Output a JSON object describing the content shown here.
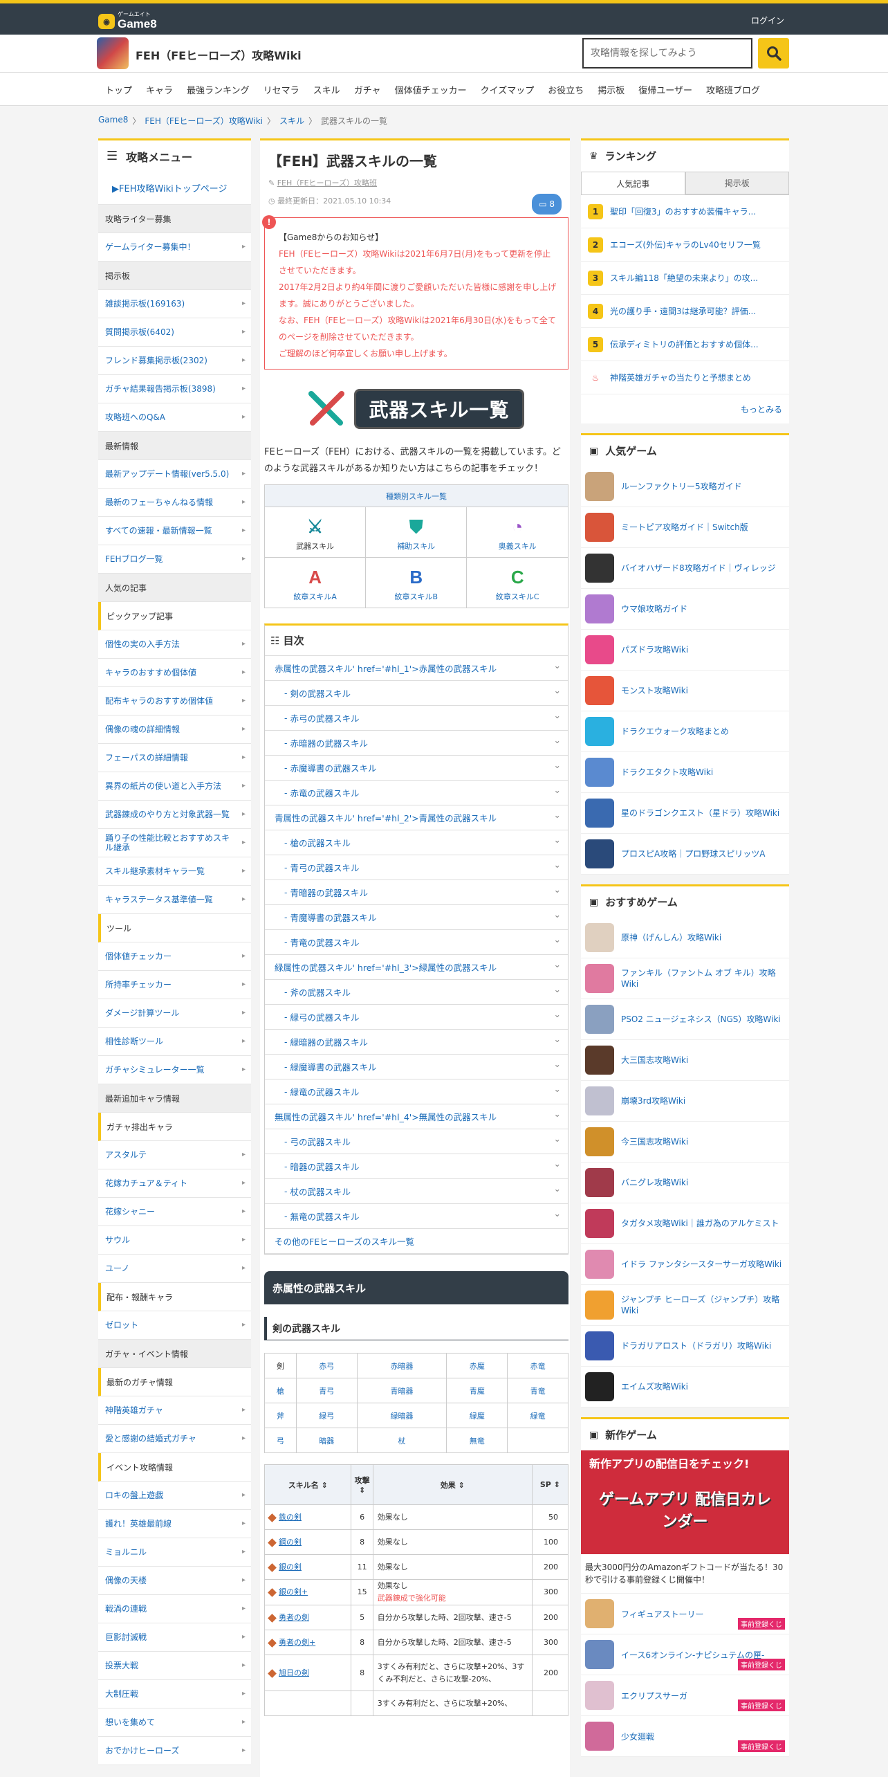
{
  "site": {
    "logo_small": "ゲームエイト",
    "logo": "Game8",
    "login": "ログイン",
    "title": "FEH（FEヒーローズ）攻略Wiki",
    "search_placeholder": "攻略情報を探してみよう"
  },
  "nav": [
    "トップ",
    "キャラ",
    "最強ランキング",
    "リセマラ",
    "スキル",
    "ガチャ",
    "個体値チェッカー",
    "クイズマップ",
    "お役立ち",
    "掲示板",
    "復帰ユーザー",
    "攻略班ブログ"
  ],
  "crumbs": [
    "Game8",
    "FEH（FEヒーローズ）攻略Wiki",
    "スキル",
    "武器スキルの一覧"
  ],
  "crumb_sep": "〉",
  "menu": {
    "title": "攻略メニュー",
    "top": "▶FEH攻略Wikiトップページ",
    "items": [
      {
        "t": "sec",
        "l": "攻略ライター募集"
      },
      {
        "t": "link",
        "l": "ゲームライター募集中！"
      },
      {
        "t": "sec",
        "l": "掲示板"
      },
      {
        "t": "link",
        "l": "雑談掲示板(169163)"
      },
      {
        "t": "link",
        "l": "質問掲示板(6402)"
      },
      {
        "t": "link",
        "l": "フレンド募集掲示板(2302)"
      },
      {
        "t": "link",
        "l": "ガチャ結果報告掲示板(3898)"
      },
      {
        "t": "link",
        "l": "攻略班へのQ&A"
      },
      {
        "t": "sec",
        "l": "最新情報"
      },
      {
        "t": "link",
        "l": "最新アップデート情報(ver5.5.0)"
      },
      {
        "t": "link",
        "l": "最新のフェーちゃんねる情報"
      },
      {
        "t": "link",
        "l": "すべての速報・最新情報一覧"
      },
      {
        "t": "link",
        "l": "FEHブログ一覧"
      },
      {
        "t": "sec",
        "l": "人気の記事"
      },
      {
        "t": "sub",
        "l": "ピックアップ記事"
      },
      {
        "t": "link",
        "l": "個性の実の入手方法"
      },
      {
        "t": "link",
        "l": "キャラのおすすめ個体値"
      },
      {
        "t": "link",
        "l": "配布キャラのおすすめ個体値"
      },
      {
        "t": "link",
        "l": "偶像の魂の詳細情報"
      },
      {
        "t": "link",
        "l": "フェーパスの詳細情報"
      },
      {
        "t": "link",
        "l": "異界の紙片の使い道と入手方法"
      },
      {
        "t": "link",
        "l": "武器錬成のやり方と対象武器一覧"
      },
      {
        "t": "link",
        "l": "踊り子の性能比較とおすすめスキル継承"
      },
      {
        "t": "link",
        "l": "スキル継承素材キャラ一覧"
      },
      {
        "t": "link",
        "l": "キャラステータス基準値一覧"
      },
      {
        "t": "sub",
        "l": "ツール"
      },
      {
        "t": "link",
        "l": "個体値チェッカー"
      },
      {
        "t": "link",
        "l": "所持率チェッカー"
      },
      {
        "t": "link",
        "l": "ダメージ計算ツール"
      },
      {
        "t": "link",
        "l": "相性診断ツール"
      },
      {
        "t": "link",
        "l": "ガチャシミュレーター一覧"
      },
      {
        "t": "sec",
        "l": "最新追加キャラ情報"
      },
      {
        "t": "sub",
        "l": "ガチャ排出キャラ"
      },
      {
        "t": "link",
        "l": "アスタルテ"
      },
      {
        "t": "link",
        "l": "花嫁カチュア＆ティト"
      },
      {
        "t": "link",
        "l": "花嫁シャニー"
      },
      {
        "t": "link",
        "l": "サウル"
      },
      {
        "t": "link",
        "l": "ユーノ"
      },
      {
        "t": "sub",
        "l": "配布・報酬キャラ"
      },
      {
        "t": "link",
        "l": "ゼロット"
      },
      {
        "t": "sec",
        "l": "ガチャ・イベント情報"
      },
      {
        "t": "sub",
        "l": "最新のガチャ情報"
      },
      {
        "t": "link",
        "l": "神階英雄ガチャ"
      },
      {
        "t": "link",
        "l": "愛と感謝の結婚式ガチャ"
      },
      {
        "t": "sub",
        "l": "イベント攻略情報"
      },
      {
        "t": "link",
        "l": "ロキの盤上遊戯"
      },
      {
        "t": "link",
        "l": "護れ！英雄最前線"
      },
      {
        "t": "link",
        "l": "ミョルニル"
      },
      {
        "t": "link",
        "l": "偶像の天楼"
      },
      {
        "t": "link",
        "l": "戦渦の連戦"
      },
      {
        "t": "link",
        "l": "巨影討滅戦"
      },
      {
        "t": "link",
        "l": "投票大戦"
      },
      {
        "t": "link",
        "l": "大制圧戦"
      },
      {
        "t": "link",
        "l": "想いを集めて"
      },
      {
        "t": "link",
        "l": "おでかけヒーローズ"
      }
    ]
  },
  "article": {
    "title": "【FEH】武器スキルの一覧",
    "author": "FEH（FEヒーローズ）攻略班",
    "updated": "最終更新日：2021.05.10 10:34",
    "comments": "8",
    "notice_title": "【Game8からのお知らせ】",
    "notice_lines": [
      "FEH（FEヒーローズ）攻略Wikiは2021年6月7日(月)をもって更新を停止させていただきます。",
      "2017年2月2日より約4年間に渡りご愛顧いただいた皆様に感謝を申し上げます。誠にありがとうございました。",
      "なお、FEH（FEヒーローズ）攻略Wikiは2021年6月30日(水)をもって全てのページを削除させていただきます。",
      "ご理解のほど何卒宜しくお願い申し上げます。"
    ],
    "banner_text": "武器スキル一覧",
    "intro": "FEヒーローズ（FEH）における、武器スキルの一覧を掲載しています。どのような武器スキルがあるか知りたい方はこちらの記事をチェック！",
    "cat_header": "種類別スキル一覧",
    "cats": [
      {
        "label": "武器スキル",
        "g": "⚔",
        "c": "#1a8a9a"
      },
      {
        "label": "補助スキル",
        "g": "⛊",
        "c": "#1aa89a"
      },
      {
        "label": "奥義スキル",
        "g": "◔",
        "c": "#9a55c8"
      },
      {
        "label": "紋章スキルA",
        "g": "A",
        "c": "#d84a4a"
      },
      {
        "label": "紋章スキルB",
        "g": "B",
        "c": "#2a6bc8"
      },
      {
        "label": "紋章スキルC",
        "g": "C",
        "c": "#2aa84a"
      }
    ],
    "toc_title": "目次",
    "toc": [
      {
        "l": "赤属性の武器スキル' href='#hl_1'>赤属性の武器スキル",
        "s": 0
      },
      {
        "l": "剣の武器スキル",
        "s": 1
      },
      {
        "l": "赤弓の武器スキル",
        "s": 1
      },
      {
        "l": "赤暗器の武器スキル",
        "s": 1
      },
      {
        "l": "赤魔導書の武器スキル",
        "s": 1
      },
      {
        "l": "赤竜の武器スキル",
        "s": 1
      },
      {
        "l": "青属性の武器スキル' href='#hl_2'>青属性の武器スキル",
        "s": 0
      },
      {
        "l": "槍の武器スキル",
        "s": 1
      },
      {
        "l": "青弓の武器スキル",
        "s": 1
      },
      {
        "l": "青暗器の武器スキル",
        "s": 1
      },
      {
        "l": "青魔導書の武器スキル",
        "s": 1
      },
      {
        "l": "青竜の武器スキル",
        "s": 1
      },
      {
        "l": "緑属性の武器スキル' href='#hl_3'>緑属性の武器スキル",
        "s": 0
      },
      {
        "l": "斧の武器スキル",
        "s": 1
      },
      {
        "l": "緑弓の武器スキル",
        "s": 1
      },
      {
        "l": "緑暗器の武器スキル",
        "s": 1
      },
      {
        "l": "緑魔導書の武器スキル",
        "s": 1
      },
      {
        "l": "緑竜の武器スキル",
        "s": 1
      },
      {
        "l": "無属性の武器スキル' href='#hl_4'>無属性の武器スキル",
        "s": 0
      },
      {
        "l": "弓の武器スキル",
        "s": 1
      },
      {
        "l": "暗器の武器スキル",
        "s": 1
      },
      {
        "l": "杖の武器スキル",
        "s": 1
      },
      {
        "l": "無竜の武器スキル",
        "s": 1
      },
      {
        "l": "その他のFEヒーローズのスキル一覧",
        "s": 0
      }
    ],
    "section": "赤属性の武器スキル",
    "subsection": "剣の武器スキル",
    "weapon_grid": [
      [
        "剣",
        "赤弓",
        "赤暗器",
        "赤魔",
        "赤竜"
      ],
      [
        "槍",
        "青弓",
        "青暗器",
        "青魔",
        "青竜"
      ],
      [
        "斧",
        "緑弓",
        "緑暗器",
        "緑魔",
        "緑竜"
      ],
      [
        "弓",
        "暗器",
        "杖",
        "無竜",
        ""
      ]
    ],
    "skill_headers": [
      "スキル名 ⇕",
      "攻撃 ⇕",
      "効果 ⇕",
      "SP ⇕"
    ],
    "skills": [
      {
        "name": "鉄の剣",
        "atk": "6",
        "eff": "効果なし",
        "eff2": "",
        "sp": "50"
      },
      {
        "name": "鋼の剣",
        "atk": "8",
        "eff": "効果なし",
        "eff2": "",
        "sp": "100"
      },
      {
        "name": "銀の剣",
        "atk": "11",
        "eff": "効果なし",
        "eff2": "",
        "sp": "200"
      },
      {
        "name": "銀の剣+",
        "atk": "15",
        "eff": "効果なし",
        "eff2": "武器錬成で強化可能",
        "sp": "300"
      },
      {
        "name": "勇者の剣",
        "atk": "5",
        "eff": "自分から攻撃した時、2回攻撃、速さ-5",
        "eff2": "",
        "sp": "200"
      },
      {
        "name": "勇者の剣+",
        "atk": "8",
        "eff": "自分から攻撃した時、2回攻撃、速さ-5",
        "eff2": "",
        "sp": "300"
      },
      {
        "name": "旭日の剣",
        "atk": "8",
        "eff": "3すくみ有利だと、さらに攻撃+20%、3すくみ不利だと、さらに攻撃-20%、",
        "eff2": "",
        "sp": "200"
      },
      {
        "name": "",
        "atk": "",
        "eff": "3すくみ有利だと、さらに攻撃+20%、",
        "eff2": "",
        "sp": ""
      }
    ]
  },
  "ranking": {
    "title": "ランキング",
    "tabs": [
      "人気記事",
      "掲示板"
    ],
    "items": [
      "聖印「回復3」のおすすめ装備キャラ...",
      "エコーズ(外伝)キャラのLv40セリフ一覧",
      "スキル編118「絶望の未来より」の攻...",
      "光の護り手・遠間3は継承可能？評価...",
      "伝承ディミトリの評価とおすすめ個体..."
    ],
    "extra": "神階英雄ガチャの当たりと予想まとめ",
    "more": "もっとみる"
  },
  "popular": {
    "title": "人気ゲーム",
    "items": [
      {
        "l": "ルーンファクトリー5攻略ガイド",
        "c": "#c9a37a"
      },
      {
        "l": "ミートピア攻略ガイド｜Switch版",
        "c": "#d9553a"
      },
      {
        "l": "バイオハザード8攻略ガイド｜ヴィレッジ",
        "c": "#333"
      },
      {
        "l": "ウマ娘攻略ガイド",
        "c": "#b07ad0"
      },
      {
        "l": "パズドラ攻略Wiki",
        "c": "#e84a8a"
      },
      {
        "l": "モンスト攻略Wiki",
        "c": "#e6553a"
      },
      {
        "l": "ドラクエウォーク攻略まとめ",
        "c": "#2ab0e0"
      },
      {
        "l": "ドラクエタクト攻略Wiki",
        "c": "#5a8ad0"
      },
      {
        "l": "星のドラゴンクエスト（星ドラ）攻略Wiki",
        "c": "#3a6ab0"
      },
      {
        "l": "プロスピA攻略｜プロ野球スピリッツA",
        "c": "#2a4a7a"
      }
    ]
  },
  "recommend": {
    "title": "おすすめゲーム",
    "items": [
      {
        "l": "原神（げんしん）攻略Wiki",
        "c": "#e0d0c0"
      },
      {
        "l": "ファンキル（ファントム オブ キル）攻略Wiki",
        "c": "#e07aa0"
      },
      {
        "l": "PSO2 ニュージェネシス（NGS）攻略Wiki",
        "c": "#8aa0c0"
      },
      {
        "l": "大三国志攻略Wiki",
        "c": "#5a3a2a"
      },
      {
        "l": "崩壊3rd攻略Wiki",
        "c": "#c0c0d0"
      },
      {
        "l": "今三国志攻略Wiki",
        "c": "#d0902a"
      },
      {
        "l": "バニグレ攻略Wiki",
        "c": "#a03a4a"
      },
      {
        "l": "タガタメ攻略Wiki｜誰ガ為のアルケミスト",
        "c": "#c03a5a"
      },
      {
        "l": "イドラ ファンタシースターサーガ攻略Wiki",
        "c": "#e08ab0"
      },
      {
        "l": "ジャンプチ ヒーローズ（ジャンプチ）攻略Wiki",
        "c": "#f0a030"
      },
      {
        "l": "ドラガリアロスト（ドラガリ）攻略Wiki",
        "c": "#3a5ab0"
      },
      {
        "l": "エイムズ攻略Wiki",
        "c": "#222"
      }
    ]
  },
  "newgames": {
    "title": "新作ゲーム",
    "banner1": "新作アプリの配信日をチェック!",
    "banner2": "ゲームアプリ 配信日カレンダー",
    "promo": "最大3000円分のAmazonギフトコードが当たる！30秒で引ける事前登録くじ開催中！",
    "items": [
      {
        "l": "フィギュアストーリー",
        "c": "#e0b070"
      },
      {
        "l": "イース6オンライン-ナピシュテムの匣-",
        "c": "#6a8ac0"
      },
      {
        "l": "エクリプスサーガ",
        "c": "#e0c0d0"
      },
      {
        "l": "少女廻戦",
        "c": "#d06a9a"
      }
    ],
    "badge": "事前登録くじ"
  }
}
